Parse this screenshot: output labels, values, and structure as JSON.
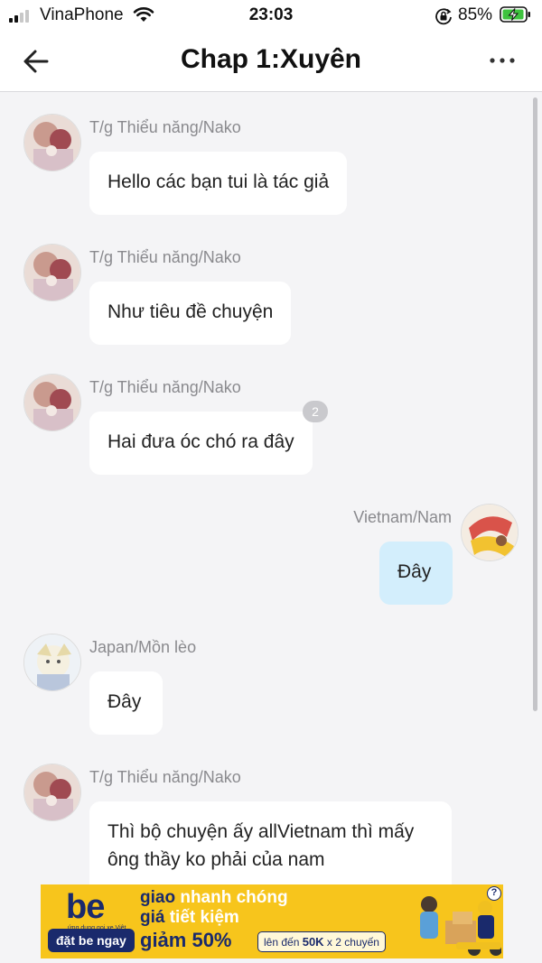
{
  "status_bar": {
    "carrier": "VinaPhone",
    "time": "23:03",
    "battery_percent": "85%",
    "signal_bars_active": 2,
    "icons": [
      "signal-icon",
      "wifi-icon",
      "orientation-lock-icon",
      "battery-charging-icon"
    ]
  },
  "header": {
    "title": "Chap 1:Xuyên",
    "icons": [
      "back-arrow-icon",
      "more-options-icon"
    ]
  },
  "messages": [
    {
      "sender": "T/g Thiểu năng/Nako",
      "text": "Hello các bạn tui là tác giả",
      "side": "left"
    },
    {
      "sender": "T/g Thiểu năng/Nako",
      "text": "Như tiêu đề chuyện",
      "side": "left"
    },
    {
      "sender": "T/g Thiểu năng/Nako",
      "text": "Hai đưa óc chó ra đây",
      "side": "left",
      "reaction_count": "2"
    },
    {
      "sender": "Vietnam/Nam",
      "text": "Đây",
      "side": "right"
    },
    {
      "sender": "Japan/Mồn lèo",
      "text": "Đây",
      "side": "left"
    },
    {
      "sender": "T/g Thiểu năng/Nako",
      "text": "Thì bộ chuyện ấy allVietnam thì mấy ông thầy ko phải của nam",
      "side": "left"
    }
  ],
  "ad": {
    "logo": "be",
    "tagline": "ứng dụng gọi xe Việt",
    "cta": "đặt be ngay",
    "line1_a": "giao",
    "line1_b": "nhanh chóng",
    "line2_a": "giá",
    "line2_b": "tiết kiệm",
    "line3": "giảm 50%",
    "pill_a": "lên đến",
    "pill_b": "50K",
    "pill_c": "x 2 chuyến",
    "help": "?"
  },
  "colors": {
    "background": "#f4f4f6",
    "bubble_other": "#ffffff",
    "bubble_mine": "#d3eefc",
    "sender_text": "#8a8a8e",
    "ad_yellow": "#f7c51c",
    "ad_navy": "#1a2a6c"
  }
}
